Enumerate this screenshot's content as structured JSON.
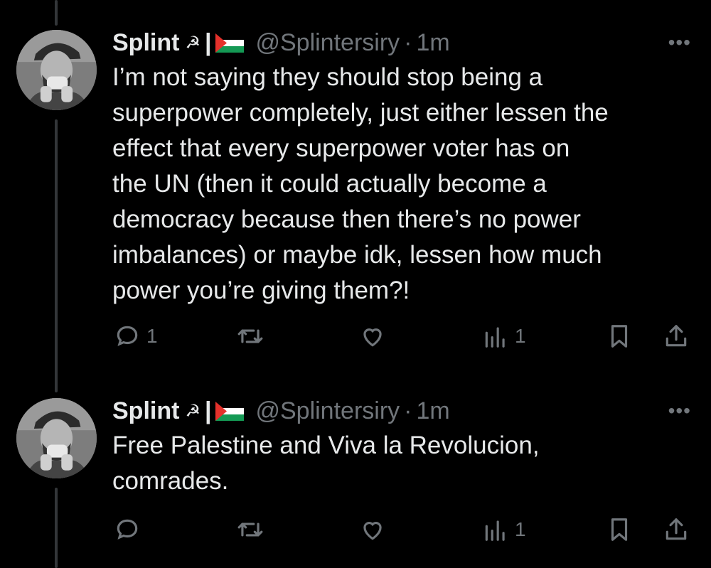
{
  "tweets": [
    {
      "display_name": "Splint",
      "name_emoji": "☭",
      "separator": "|",
      "handle": "@Splintersiry",
      "dot": "·",
      "time": "1m",
      "more": "•••",
      "text": "I’m not saying they should stop being a\nsuperpower completely, just either lessen the\neffect that every superpower voter has on\nthe UN (then it could actually become a\ndemocracy because then there’s no power\nimbalances) or maybe idk, lessen how much\npower you’re giving them?!",
      "reply_count": "1",
      "retweet_count": "",
      "like_count": "",
      "view_count": "1"
    },
    {
      "display_name": "Splint",
      "name_emoji": "☭",
      "separator": "|",
      "handle": "@Splintersiry",
      "dot": "·",
      "time": "1m",
      "more": "•••",
      "text": "Free Palestine and Viva la Revolucion,\ncomrades.",
      "reply_count": "",
      "retweet_count": "",
      "like_count": "",
      "view_count": "1"
    }
  ],
  "icons": [
    "reply-icon",
    "retweet-icon",
    "like-icon",
    "views-icon",
    "bookmark-icon",
    "share-icon"
  ],
  "colors": {
    "background": "#000000",
    "text": "#e7e9ea",
    "muted": "#71767b",
    "thread_line": "#333639"
  }
}
